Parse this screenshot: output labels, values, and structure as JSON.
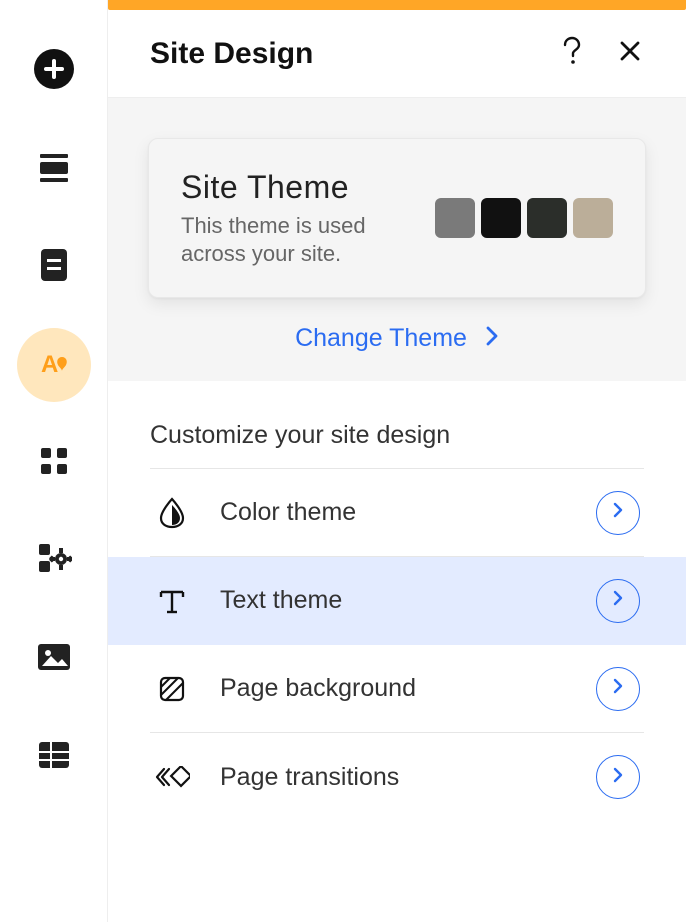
{
  "header": {
    "title": "Site Design"
  },
  "theme": {
    "title": "Site Theme",
    "description": "This theme is used across your site.",
    "swatches": [
      "#7a7a7a",
      "#111111",
      "#2b2e2a",
      "#bbae99"
    ],
    "change_label": "Change Theme"
  },
  "customize": {
    "heading": "Customize your site design",
    "options": {
      "color": "Color theme",
      "text": "Text theme",
      "background": "Page background",
      "transitions": "Page transitions"
    },
    "selected": "text"
  },
  "colors": {
    "accent": "#2b6cf1",
    "sidebar_active_bg": "#ffe7bd",
    "sidebar_active_fg": "#ff9f1a"
  }
}
